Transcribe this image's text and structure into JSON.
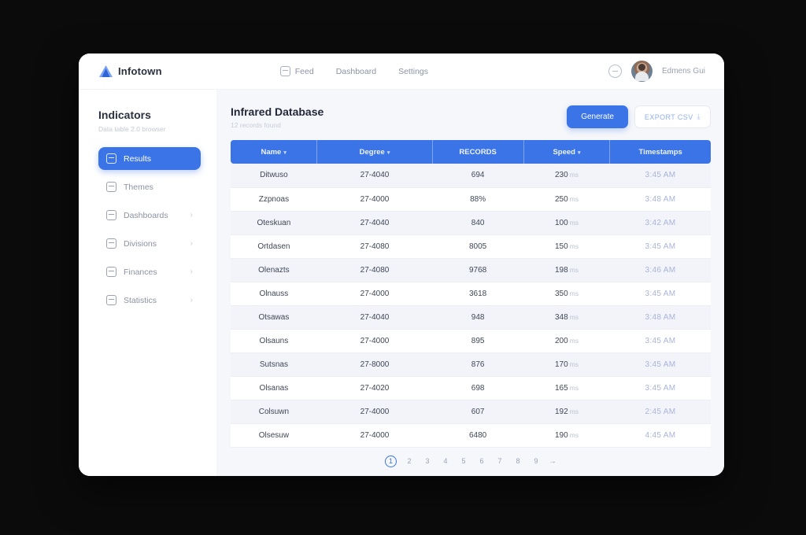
{
  "brand": {
    "name": "Infotown"
  },
  "topnav": {
    "items": [
      "Feed",
      "Dashboard",
      "Settings"
    ]
  },
  "user": {
    "name": "Edmens Gui"
  },
  "sidebar": {
    "title": "Indicators",
    "subtitle": "Data table 2.0 browser",
    "items": [
      {
        "label": "Results",
        "icon": "file-icon",
        "active": true,
        "chevron": false
      },
      {
        "label": "Themes",
        "icon": "image-icon",
        "active": false,
        "chevron": false
      },
      {
        "label": "Dashboards",
        "icon": "folder-icon",
        "active": false,
        "chevron": true
      },
      {
        "label": "Divisions",
        "icon": "layers-icon",
        "active": false,
        "chevron": true
      },
      {
        "label": "Finances",
        "icon": "wallet-icon",
        "active": false,
        "chevron": true
      },
      {
        "label": "Statistics",
        "icon": "chart-icon",
        "active": false,
        "chevron": true
      }
    ],
    "chevron_glyph": "›"
  },
  "main": {
    "title": "Infrared Database",
    "subtitle": "12 records found",
    "actions": {
      "primary": "Generate",
      "secondary": "EXPORT CSV",
      "secondary_icon": "download-icon",
      "download_glyph": "⤓"
    }
  },
  "accent_color": "#3b74e6",
  "table": {
    "columns": [
      {
        "label": "Name",
        "sort": "▾"
      },
      {
        "label": "Degree",
        "sort": "▾"
      },
      {
        "label": "RECORDS",
        "sort": ""
      },
      {
        "label": "Speed",
        "sort": "▾"
      },
      {
        "label": "Timestamps",
        "sort": ""
      }
    ],
    "rows": [
      {
        "name": "Ditwuso",
        "degree": "27-4040",
        "records": "694",
        "speed": "230",
        "speed_unit": "ms",
        "timestamp": "3:45 AM"
      },
      {
        "name": "Zzpnoas",
        "degree": "27-4000",
        "records": "88%",
        "speed": "250",
        "speed_unit": "ms",
        "timestamp": "3:48 AM"
      },
      {
        "name": "Oteskuan",
        "degree": "27-4040",
        "records": "840",
        "speed": "100",
        "speed_unit": "ms",
        "timestamp": "3:42 AM"
      },
      {
        "name": "Ortdasen",
        "degree": "27-4080",
        "records": "8005",
        "speed": "150",
        "speed_unit": "ms",
        "timestamp": "3:45 AM"
      },
      {
        "name": "Olenazts",
        "degree": "27-4080",
        "records": "9768",
        "speed": "198",
        "speed_unit": "ms",
        "timestamp": "3:46 AM"
      },
      {
        "name": "Olnauss",
        "degree": "27-4000",
        "records": "3618",
        "speed": "350",
        "speed_unit": "ms",
        "timestamp": "3:45 AM"
      },
      {
        "name": "Otsawas",
        "degree": "27-4040",
        "records": "948",
        "speed": "348",
        "speed_unit": "ms",
        "timestamp": "3:48 AM"
      },
      {
        "name": "Olsauns",
        "degree": "27-4000",
        "records": "895",
        "speed": "200",
        "speed_unit": "ms",
        "timestamp": "3:45 AM"
      },
      {
        "name": "Sutsnas",
        "degree": "27-8000",
        "records": "876",
        "speed": "170",
        "speed_unit": "ms",
        "timestamp": "3:45 AM"
      },
      {
        "name": "Olsanas",
        "degree": "27-4020",
        "records": "698",
        "speed": "165",
        "speed_unit": "ms",
        "timestamp": "3:45 AM"
      },
      {
        "name": "Colsuwn",
        "degree": "27-4000",
        "records": "607",
        "speed": "192",
        "speed_unit": "ms",
        "timestamp": "2:45 AM"
      },
      {
        "name": "Olsesuw",
        "degree": "27-4000",
        "records": "6480",
        "speed": "190",
        "speed_unit": "ms",
        "timestamp": "4:45 AM"
      }
    ]
  },
  "pagination": {
    "pages": [
      "1",
      "2",
      "3",
      "4",
      "5",
      "6",
      "7",
      "8",
      "9"
    ],
    "active_index": 0,
    "next_glyph": "→"
  }
}
